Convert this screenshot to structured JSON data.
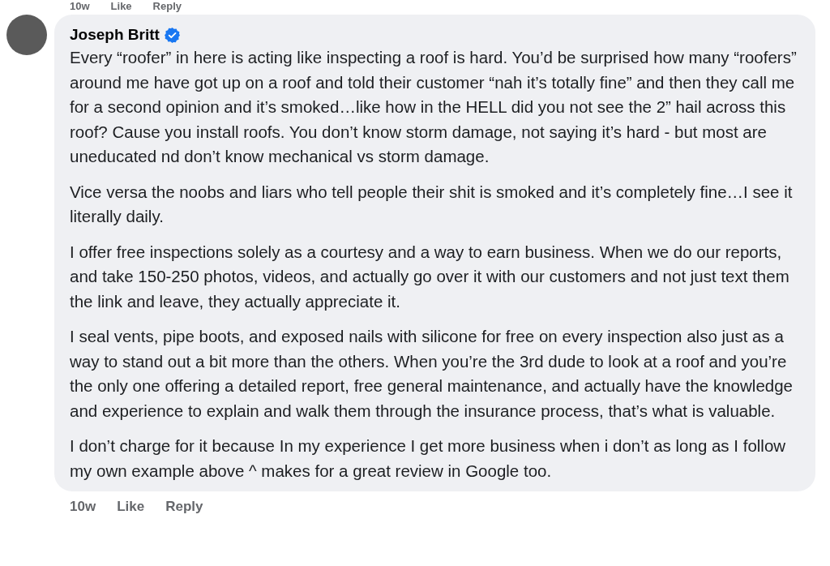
{
  "previous_comment_footer": {
    "time": "10w",
    "actions": [
      "Like",
      "Reply"
    ]
  },
  "comment": {
    "author": "Joseph Britt",
    "verified": true,
    "paragraphs": [
      "Every “roofer” in here is acting like inspecting a roof is hard. You’d be surprised how many “roofers” around me have got up on a roof and told their customer “nah it’s totally fine” and then they call me for a second opinion and it’s smoked…like how in the HELL did you not see the 2” hail across this roof? Cause you install roofs. You don’t know storm damage, not saying it’s hard - but most are uneducated nd don’t know mechanical vs storm damage.",
      "Vice versa the noobs and liars who tell people their shit is smoked and it’s completely fine…I see it literally daily.",
      "I offer free inspections solely as a courtesy and a way to earn business. When we do our reports, and take 150-250 photos, videos, and actually go over it with our customers and not just text them the link and leave, they actually appreciate it.",
      "I seal vents, pipe boots, and exposed nails with silicone for free on every inspection also just as a way to stand out a bit more than the others. When you’re the 3rd dude to look at a roof and you’re the only one offering a detailed report, free general maintenance, and actually have the knowledge and experience to explain and walk them through the insurance process, that’s what is valuable.",
      "I don’t charge for it because In my experience I get more business when i don’t as long as I follow my own example above ^ makes for a great review in Google too."
    ],
    "footer": {
      "time": "10w",
      "actions": [
        "Like",
        "Reply"
      ]
    }
  }
}
